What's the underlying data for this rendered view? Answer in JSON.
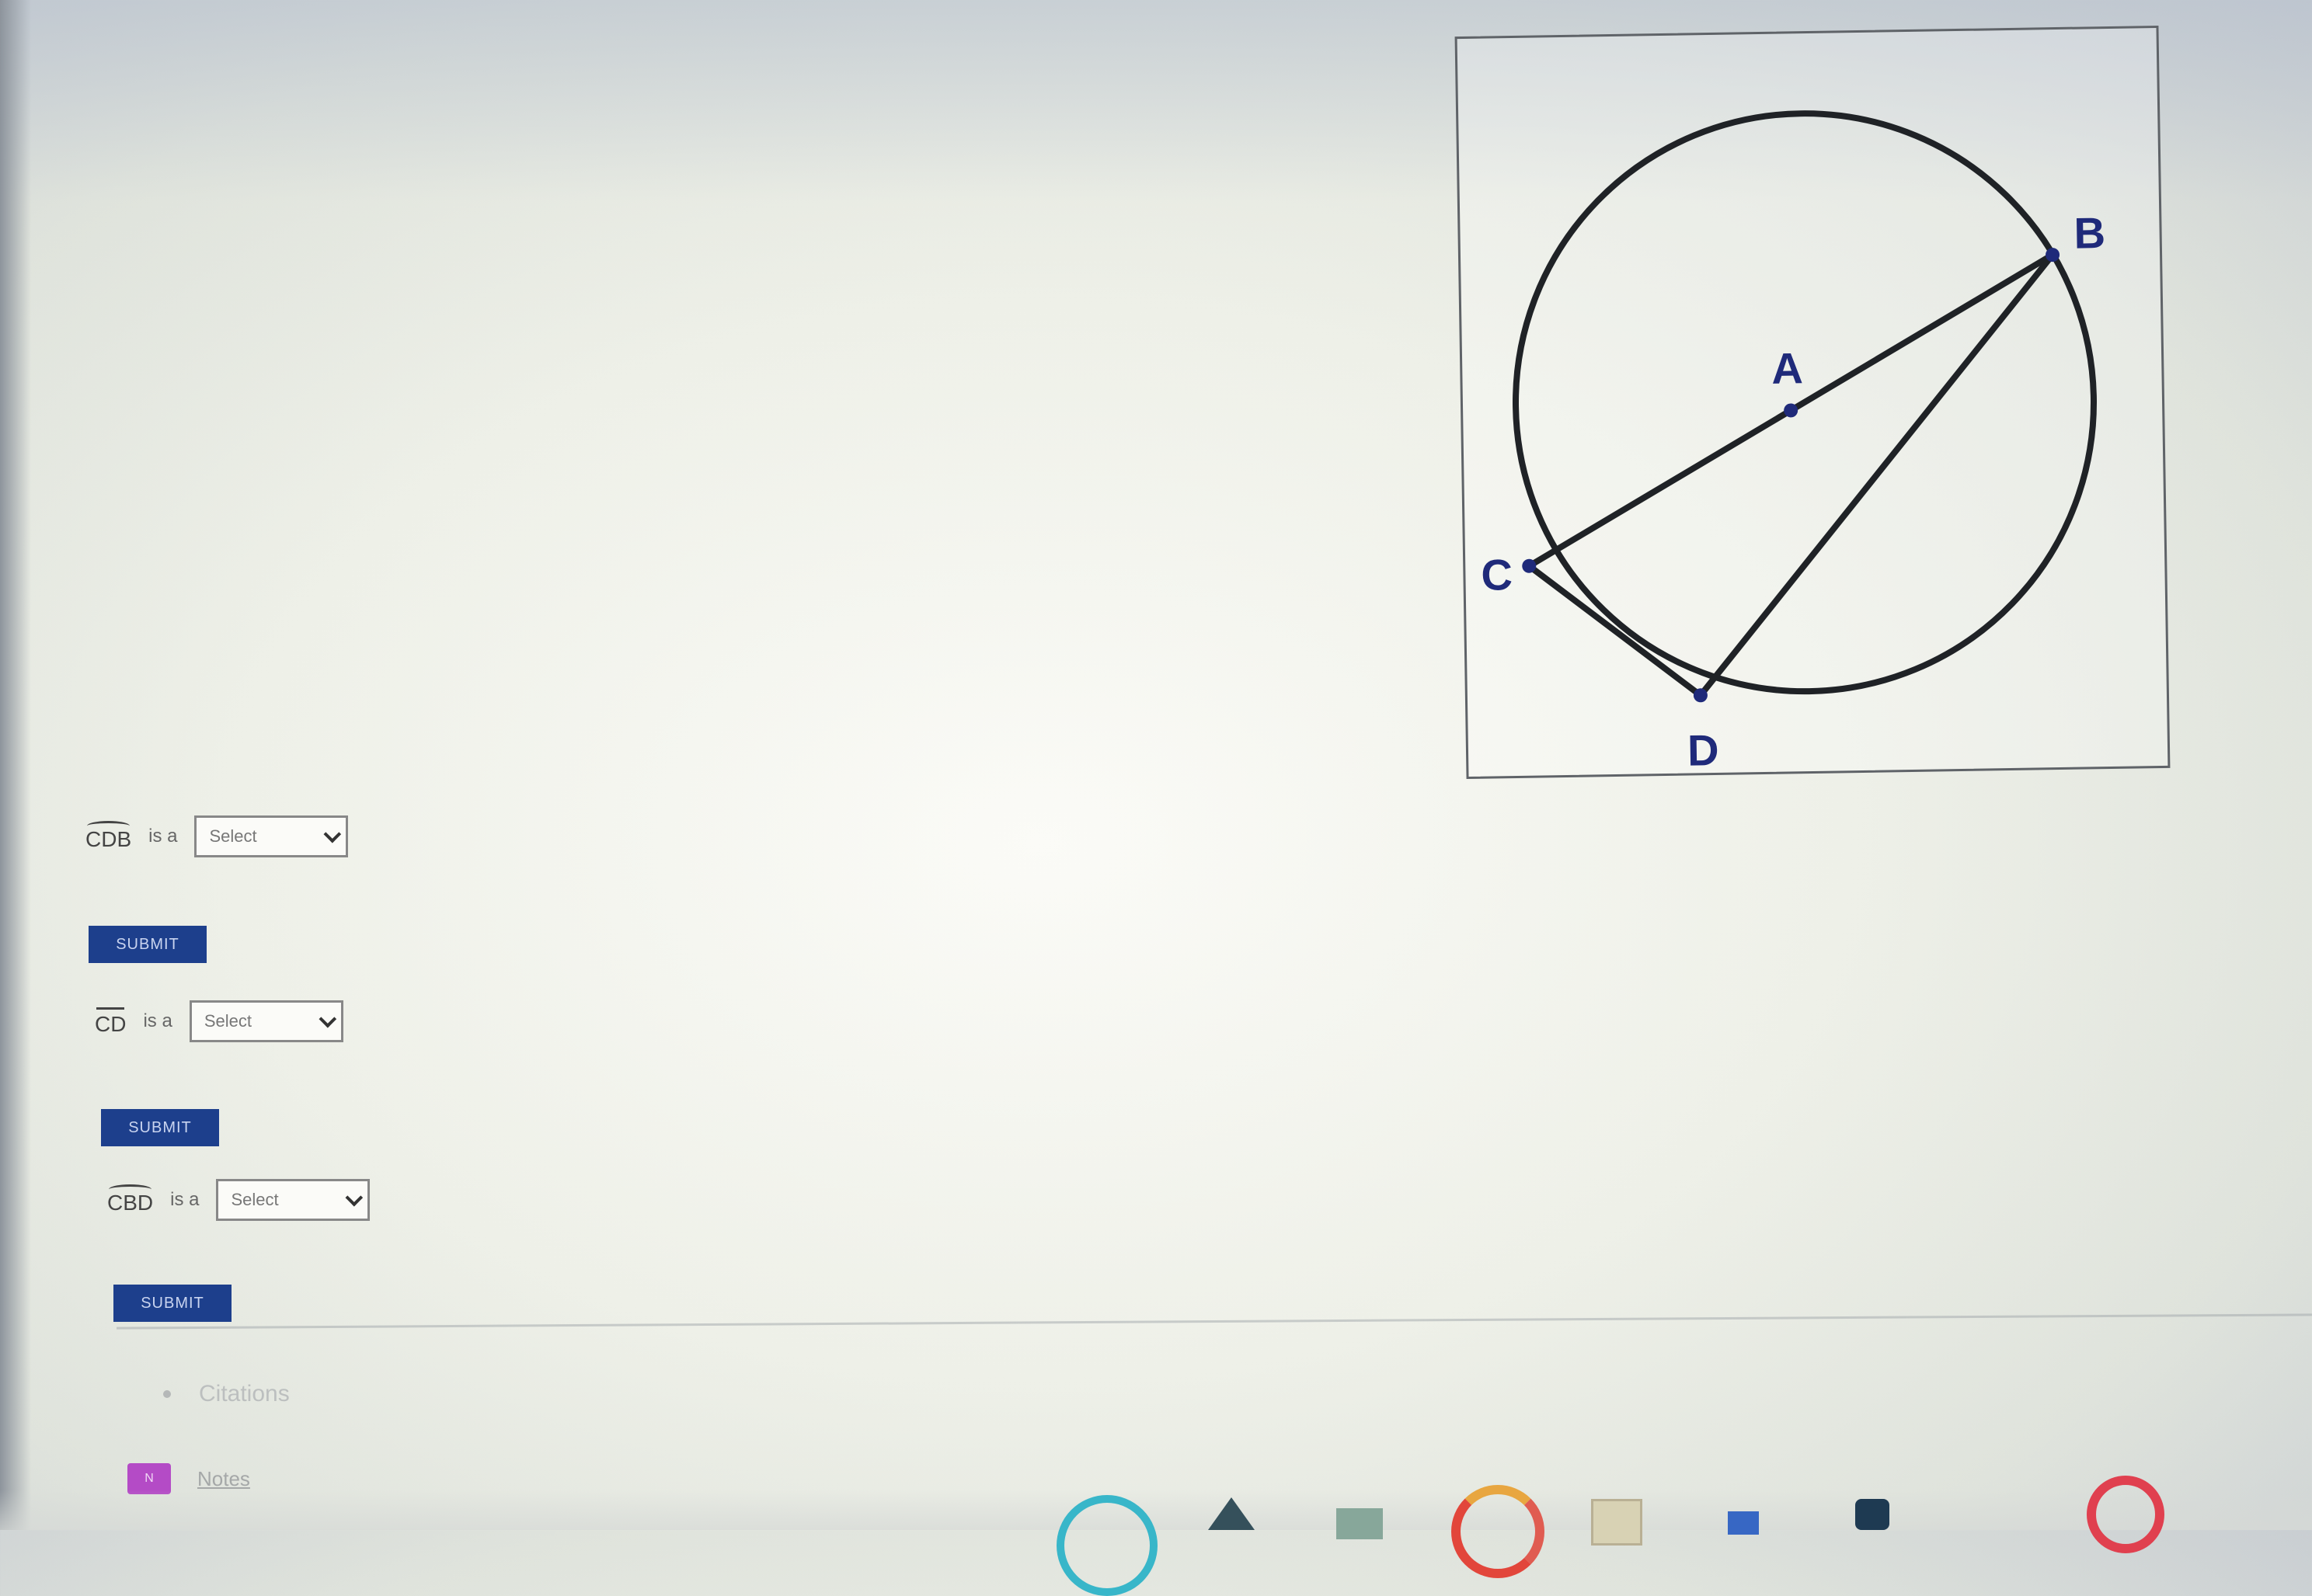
{
  "diagram": {
    "points": {
      "A": "A",
      "B": "B",
      "C": "C",
      "D": "D"
    }
  },
  "questions": [
    {
      "term": "CDB",
      "term_style": "arc",
      "connector": "is a",
      "select_value": "Select",
      "submit_label": "SUBMIT"
    },
    {
      "term": "CD",
      "term_style": "segment",
      "connector": "is a",
      "select_value": "Select",
      "submit_label": "SUBMIT"
    },
    {
      "term": "CBD",
      "term_style": "arc",
      "connector": "is a",
      "select_value": "Select",
      "submit_label": "SUBMIT"
    }
  ],
  "footer": {
    "list_item": "Citations",
    "badge_label": "N",
    "badge_text": "Notes"
  },
  "colors": {
    "submit_bg": "#1d3f8c",
    "point_color": "#1f2a7a",
    "badge_bg": "#b44bc6"
  },
  "taskbar": {
    "icons": [
      "cyan-app-icon",
      "dark-app-icon",
      "green-app-icon",
      "chrome-icon",
      "book-icon",
      "blue-app-icon",
      "lock-icon",
      "red-app-icon"
    ]
  }
}
